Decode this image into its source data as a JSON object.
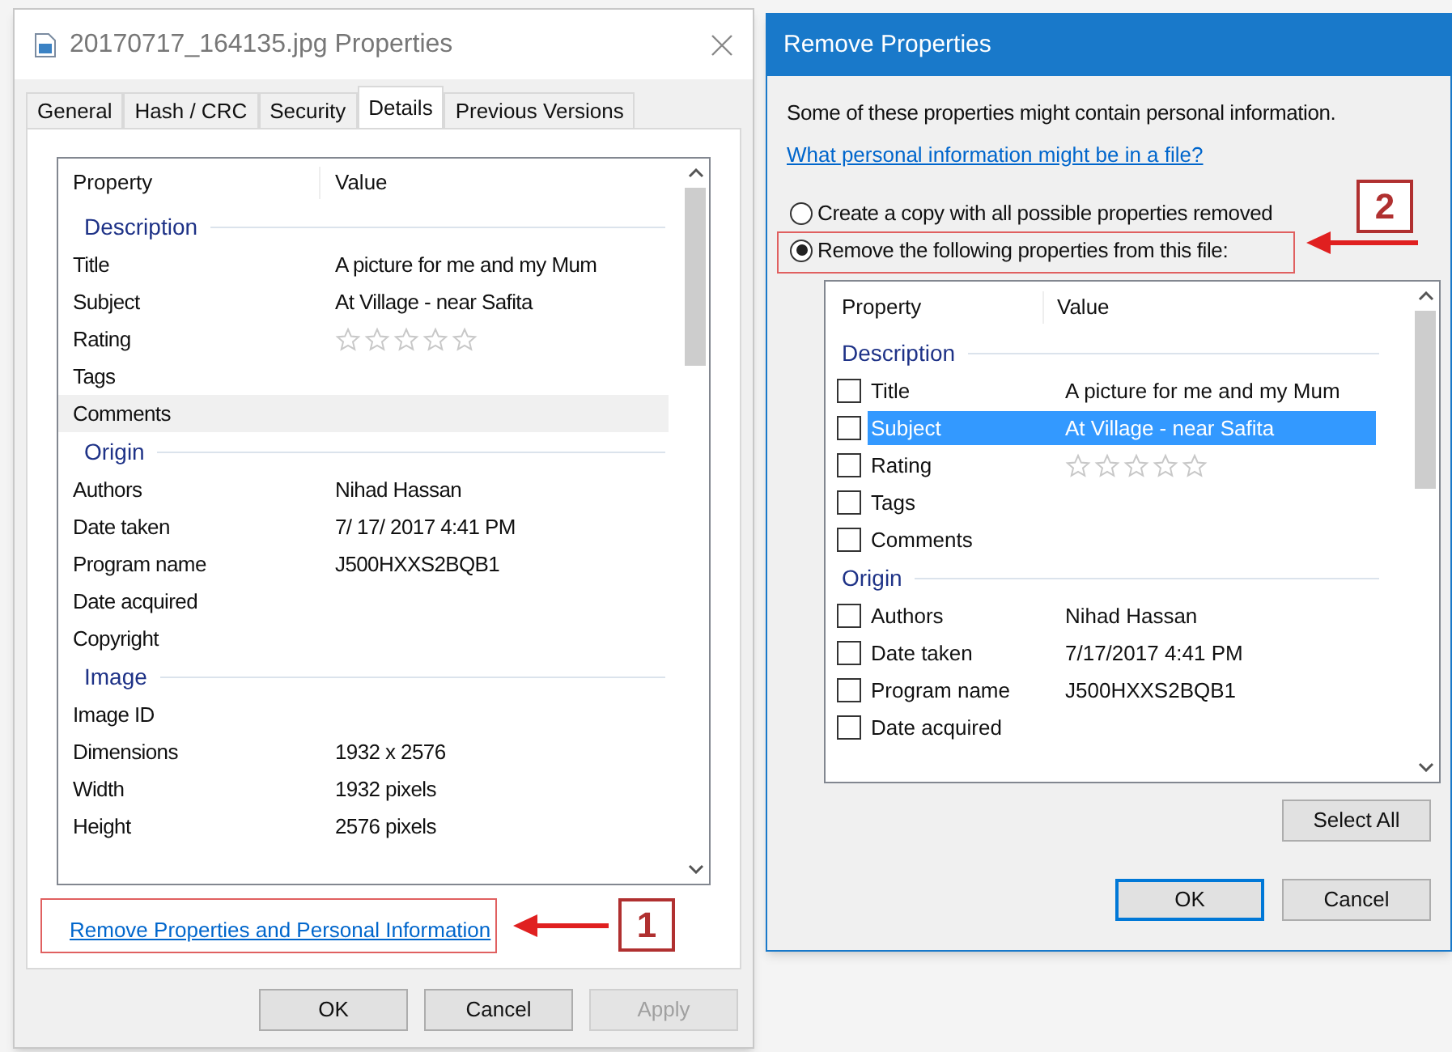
{
  "properties_dialog": {
    "title": "20170717_164135.jpg Properties",
    "tabs": [
      {
        "label": "General",
        "selected": false
      },
      {
        "label": "Hash / CRC",
        "selected": false
      },
      {
        "label": "Security",
        "selected": false
      },
      {
        "label": "Details",
        "selected": true
      },
      {
        "label": "Previous Versions",
        "selected": false
      }
    ],
    "table": {
      "columns": [
        "Property",
        "Value"
      ],
      "groups": [
        {
          "name": "Description",
          "rows": [
            {
              "kind": "text",
              "property": "Title",
              "value": "A picture for me and my Mum",
              "hovered": false
            },
            {
              "kind": "text",
              "property": "Subject",
              "value": "At Village - near Safita",
              "hovered": false
            },
            {
              "kind": "stars",
              "property": "Rating",
              "stars": 0,
              "hovered": false
            },
            {
              "kind": "text",
              "property": "Tags",
              "hovered": false
            },
            {
              "kind": "text",
              "property": "Comments",
              "hovered": true
            }
          ]
        },
        {
          "name": "Origin",
          "rows": [
            {
              "kind": "text",
              "property": "Authors",
              "value": "Nihad Hassan",
              "hovered": false
            },
            {
              "kind": "text",
              "property": "Date taken",
              "value": "7/ 17/ 2017 4:41 PM",
              "hovered": false
            },
            {
              "kind": "text",
              "property": "Program name",
              "value": "J500HXXS2BQB1",
              "hovered": false
            },
            {
              "kind": "text",
              "property": "Date acquired",
              "hovered": false
            },
            {
              "kind": "text",
              "property": "Copyright",
              "hovered": false
            }
          ]
        },
        {
          "name": "Image",
          "rows": [
            {
              "kind": "text",
              "property": "Image ID",
              "hovered": false
            },
            {
              "kind": "text",
              "property": "Dimensions",
              "value": "1932 x 2576",
              "hovered": false
            },
            {
              "kind": "text",
              "property": "Width",
              "value": "1932 pixels",
              "hovered": false
            },
            {
              "kind": "text",
              "property": "Height",
              "value": "2576 pixels",
              "hovered": false
            }
          ]
        }
      ]
    },
    "link": "Remove Properties and Personal Information",
    "buttons": [
      {
        "label": "OK",
        "disabled": false
      },
      {
        "label": "Cancel",
        "disabled": false
      },
      {
        "label": "Apply",
        "disabled": true
      }
    ]
  },
  "remove_dialog": {
    "title": "Remove Properties",
    "intro": "Some of these properties might contain personal information.",
    "link": "What personal information might be in a file?",
    "options": [
      {
        "label": "Create a copy with all possible properties removed",
        "selected": false
      },
      {
        "label": "Remove the following properties from this file:",
        "selected": true
      }
    ],
    "table": {
      "columns": [
        "Property",
        "Value"
      ],
      "groups": [
        {
          "name": "Description",
          "rows": [
            {
              "kind": "text",
              "property": "Title",
              "value": "A picture for me and my Mum",
              "checked": false,
              "selected": false
            },
            {
              "kind": "text",
              "property": "Subject",
              "value": "At Village - near Safita",
              "checked": false,
              "selected": true
            },
            {
              "kind": "stars",
              "property": "Rating",
              "stars": 0,
              "checked": false,
              "selected": false
            },
            {
              "kind": "text",
              "property": "Tags",
              "checked": false,
              "selected": false
            },
            {
              "kind": "text",
              "property": "Comments",
              "checked": false,
              "selected": false
            }
          ]
        },
        {
          "name": "Origin",
          "rows": [
            {
              "kind": "text",
              "property": "Authors",
              "value": "Nihad Hassan",
              "checked": false,
              "selected": false
            },
            {
              "kind": "text",
              "property": "Date taken",
              "value": "7/17/2017 4:41 PM",
              "checked": false,
              "selected": false
            },
            {
              "kind": "text",
              "property": "Program name",
              "value": "J500HXXS2BQB1",
              "checked": false,
              "selected": false
            },
            {
              "kind": "text",
              "property": "Date acquired",
              "checked": false,
              "selected": false
            }
          ]
        }
      ]
    },
    "select_all": "Select All",
    "buttons": [
      {
        "label": "OK",
        "default": true
      },
      {
        "label": "Cancel",
        "default": false
      }
    ]
  },
  "callouts": [
    {
      "number": "1"
    },
    {
      "number": "2"
    }
  ]
}
